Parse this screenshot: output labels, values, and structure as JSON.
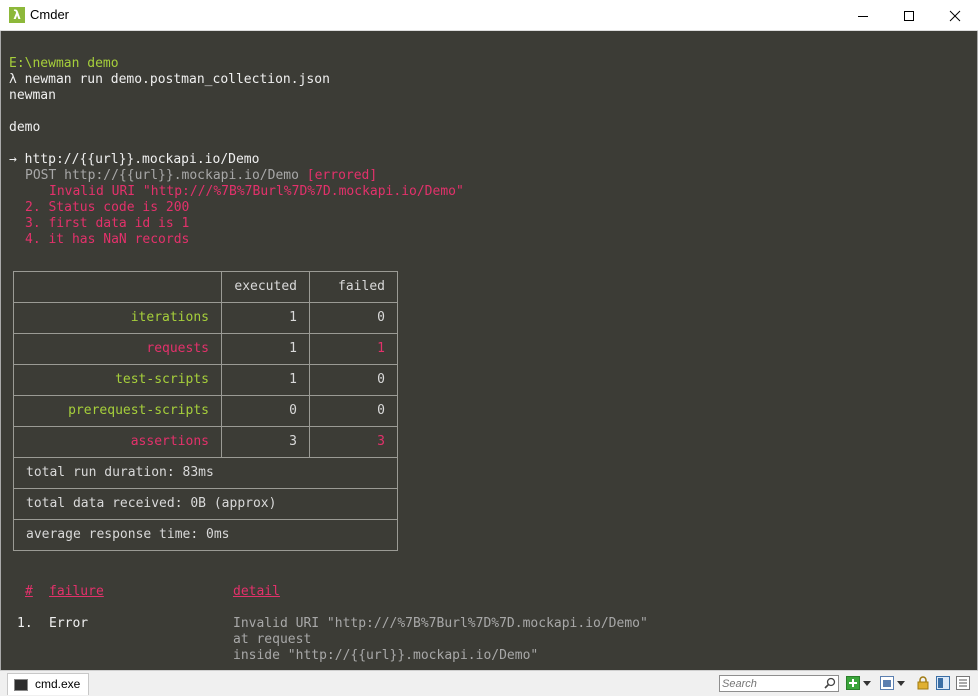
{
  "window": {
    "title": "Cmder",
    "icon": "lambda-icon"
  },
  "terminal": {
    "path": "E:\\newman demo",
    "command": "λ newman run demo.postman_collection.json",
    "tool": "newman",
    "collection": "demo",
    "request_name": "→ http://{{url}}.mockapi.io/Demo",
    "request_method": "POST http://{{url}}.mockapi.io/Demo",
    "request_status": "[errored]",
    "error_message": "Invalid URI \"http:///%7B%7Burl%7D%7D.mockapi.io/Demo\"",
    "assertions": [
      "2. Status code is 200",
      "3. first data id is 1",
      "4. it has NaN records"
    ],
    "table": {
      "headers": [
        "",
        "executed",
        "failed"
      ],
      "rows": [
        {
          "label": "iterations",
          "executed": "1",
          "failed": "0",
          "status": "ok"
        },
        {
          "label": "requests",
          "executed": "1",
          "failed": "1",
          "status": "fail"
        },
        {
          "label": "test-scripts",
          "executed": "1",
          "failed": "0",
          "status": "ok"
        },
        {
          "label": "prerequest-scripts",
          "executed": "0",
          "failed": "0",
          "status": "ok"
        },
        {
          "label": "assertions",
          "executed": "3",
          "failed": "3",
          "status": "fail"
        }
      ],
      "summary": [
        "total run duration: 83ms",
        "total data received: 0B (approx)",
        "average response time: 0ms"
      ]
    },
    "failures": {
      "headers": {
        "num": "#",
        "failure": "failure",
        "detail": "detail"
      },
      "items": [
        {
          "num": "1.",
          "failure": "Error",
          "detail": [
            "Invalid URI \"http:///%7B%7Burl%7D%7D.mockapi.io/Demo\"",
            "at request",
            "inside \"http://{{url}}.mockapi.io/Demo\""
          ]
        }
      ]
    }
  },
  "statusbar": {
    "tab_label": "cmd.exe",
    "search_placeholder": "Search"
  },
  "colors": {
    "green": "#a6cf3b",
    "red": "#e3316b",
    "background": "#3c3c36"
  }
}
